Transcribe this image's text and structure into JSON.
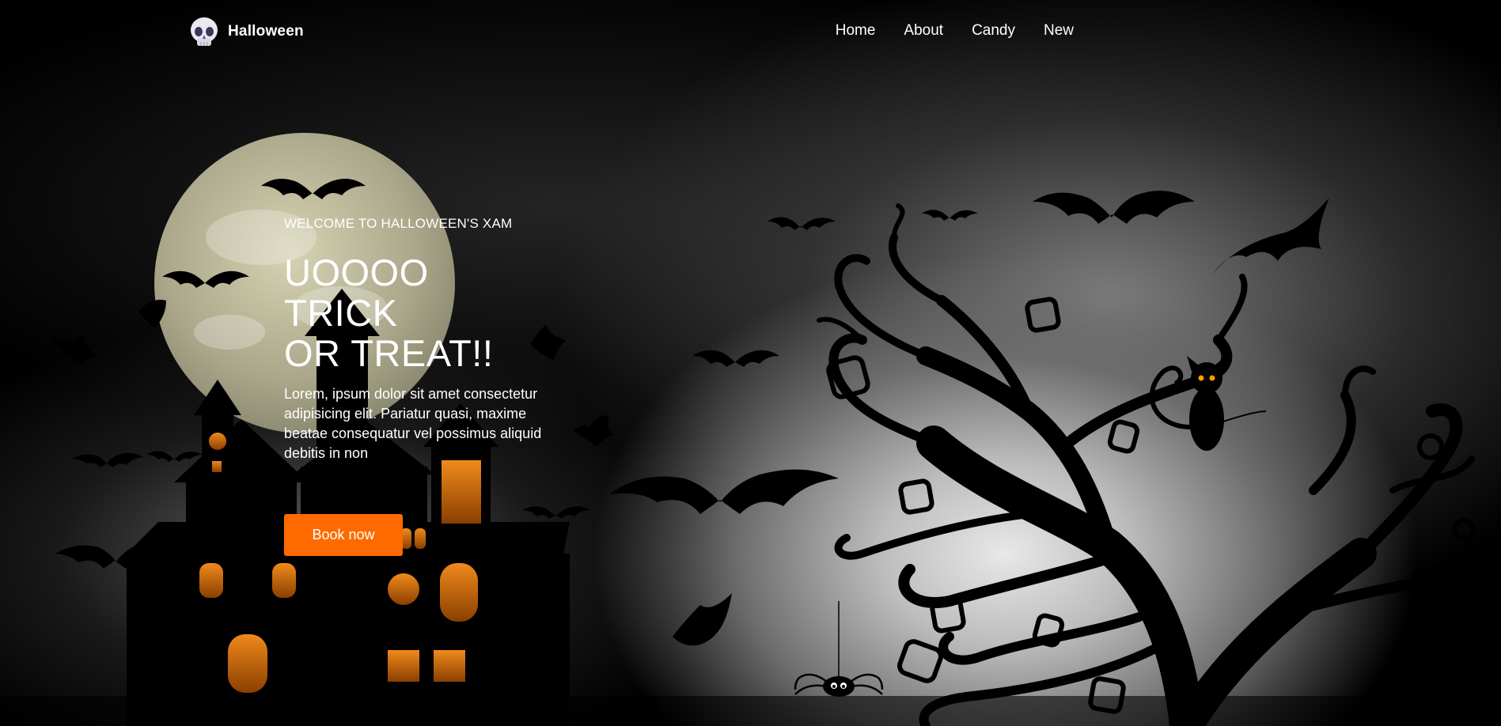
{
  "nav": {
    "logo_text": "Halloween",
    "logo_icon": "skull-icon",
    "links": [
      "Home",
      "About",
      "Candy",
      "New"
    ]
  },
  "hero": {
    "kicker": "WELCOME TO HALLOWEEN'S XAM",
    "title_line1": "UOOOO TRICK",
    "title_line2": "OR TREAT!!",
    "description": "Lorem, ipsum dolor sit amet consectetur adipisicing elit. Pariatur quasi, maxime beatae consequatur vel possimus aliquid debitis in non",
    "button_label": "Book now"
  },
  "colors": {
    "accent": "#ff6a00",
    "moon": "#c9c6a4",
    "window_glow": "#e8730c",
    "background": "#000000"
  }
}
